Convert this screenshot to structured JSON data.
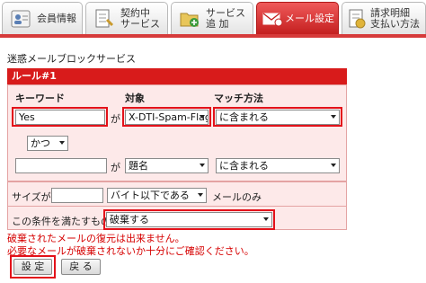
{
  "tabs": [
    {
      "label_lines": [
        "会員情報"
      ],
      "icon": "person-icon",
      "active": false
    },
    {
      "label_lines": [
        "契約中",
        "サービス"
      ],
      "icon": "document-icon",
      "active": false
    },
    {
      "label_lines": [
        "サービス",
        "追 加"
      ],
      "icon": "folder-add-icon",
      "active": false
    },
    {
      "label_lines": [
        "メール設定"
      ],
      "icon": "mail-icon",
      "active": true
    },
    {
      "label_lines": [
        "請求明細",
        "支払い方法"
      ],
      "icon": "invoice-icon",
      "active": false
    }
  ],
  "page": {
    "section_title": "迷惑メールブロックサービス",
    "rule_header": "ルール#1"
  },
  "headers": {
    "keyword": "キーワード",
    "target": "対象",
    "match": "マッチ方法"
  },
  "row1": {
    "keyword_value": "Yes",
    "ga_label": "が",
    "target_value": "X-DTI-Spam-Flag:",
    "match_value": "に含まれる"
  },
  "conjunction": {
    "value": "かつ"
  },
  "row2": {
    "keyword_value": "",
    "ga_label": "が",
    "target_value": "題名",
    "match_value": "に含まれる"
  },
  "size_row": {
    "label": "サイズが",
    "value": "",
    "condition_value": "バイト以下である",
    "suffix": "メールのみ"
  },
  "action_row": {
    "label": "この条件を満たすものを",
    "value": "破棄する"
  },
  "warnings": {
    "line1": "破棄されたメールの復元は出来ません。",
    "line2": "必要なメールが破棄されないか十分にご確認ください。"
  },
  "buttons": {
    "submit": "設 定",
    "back": "戻 る"
  },
  "colors": {
    "accent": "#d81b1b",
    "highlight": "#e3121a",
    "panel": "#fde9e9",
    "warning_text": "#d60000"
  }
}
